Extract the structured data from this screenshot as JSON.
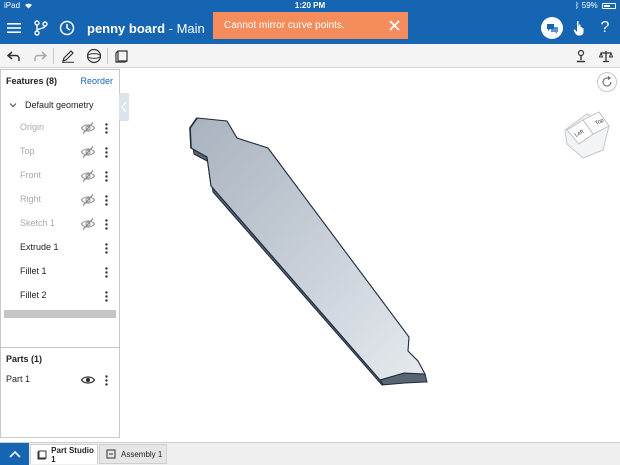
{
  "status_bar": {
    "device": "iPad",
    "wifi_icon": "wifi-icon",
    "time": "1:20 PM",
    "bluetooth_icon": "bluetooth-icon",
    "battery": "59%"
  },
  "header": {
    "doc_name": "penny board",
    "separator": " - ",
    "workspace": "Main",
    "toast": "Cannot mirror curve points.",
    "icons": [
      "menu-icon",
      "branch-icon",
      "history-icon",
      "close-icon",
      "comments-icon",
      "touch-hand-icon",
      "help-icon"
    ],
    "help_label": "?"
  },
  "toolbar": {
    "tools": [
      "undo-icon",
      "redo-icon",
      "sketch-pencil-icon",
      "plane-view-icon",
      "part-box-icon",
      "mate-connector-icon",
      "mass-scale-icon"
    ]
  },
  "features": {
    "title": "Features (8)",
    "reorder_label": "Reorder",
    "group_label": "Default geometry",
    "items": [
      {
        "label": "Origin",
        "hidden": true
      },
      {
        "label": "Top",
        "hidden": true
      },
      {
        "label": "Front",
        "hidden": true
      },
      {
        "label": "Right",
        "hidden": true
      },
      {
        "label": "Sketch 1",
        "hidden": true
      },
      {
        "label": "Extrude 1",
        "hidden": false
      },
      {
        "label": "Fillet 1",
        "hidden": false
      },
      {
        "label": "Fillet 2",
        "hidden": false
      }
    ]
  },
  "parts": {
    "title": "Parts (1)",
    "items": [
      {
        "label": "Part 1"
      }
    ]
  },
  "view_cube": {
    "top_face": "Top",
    "left_face": "Left"
  },
  "tabs": {
    "items": [
      {
        "label": "Part Studio 1",
        "active": true
      },
      {
        "label": "Assembly 1",
        "active": false
      }
    ]
  },
  "colors": {
    "brand": "#1565b3",
    "toast": "#f48c5c",
    "part_face": "#c3cbd4",
    "part_edge": "#1d2a3c"
  }
}
